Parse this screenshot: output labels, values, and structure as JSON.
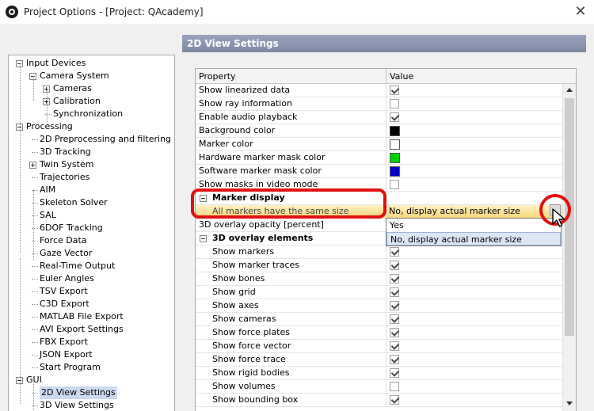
{
  "window": {
    "title": "Project Options - [Project: QAcademy]",
    "close_glyph": "✕"
  },
  "tree": [
    {
      "label": "Input Devices",
      "expander": "minus"
    },
    {
      "label": "Camera System",
      "expander": "minus"
    },
    {
      "label": "Cameras",
      "expander": "plus"
    },
    {
      "label": "Calibration",
      "expander": "plus"
    },
    {
      "label": "Synchronization"
    },
    {
      "label": "Processing",
      "expander": "minus"
    },
    {
      "label": "2D Preprocessing and filtering"
    },
    {
      "label": "3D Tracking"
    },
    {
      "label": "Twin System",
      "expander": "plus"
    },
    {
      "label": "Trajectories"
    },
    {
      "label": "AIM"
    },
    {
      "label": "Skeleton Solver"
    },
    {
      "label": "SAL"
    },
    {
      "label": "6DOF Tracking"
    },
    {
      "label": "Force Data"
    },
    {
      "label": "Gaze Vector"
    },
    {
      "label": "Real-Time Output"
    },
    {
      "label": "Euler Angles"
    },
    {
      "label": "TSV Export"
    },
    {
      "label": "C3D Export"
    },
    {
      "label": "MATLAB File Export"
    },
    {
      "label": "AVI Export Settings"
    },
    {
      "label": "FBX Export"
    },
    {
      "label": "JSON Export"
    },
    {
      "label": "Start Program"
    },
    {
      "label": "GUI",
      "expander": "minus"
    },
    {
      "label": "2D View Settings",
      "selected": true
    },
    {
      "label": "3D View Settings"
    }
  ],
  "settings": {
    "header": "2D View Settings",
    "col_property": "Property",
    "col_value": "Value",
    "rows": [
      {
        "name": "Show linearized data",
        "type": "check",
        "checked": true
      },
      {
        "name": "Show ray information",
        "type": "check",
        "checked": false
      },
      {
        "name": "Enable audio playback",
        "type": "check",
        "checked": true
      },
      {
        "name": "Background color",
        "type": "color",
        "color": "#000000"
      },
      {
        "name": "Marker color",
        "type": "color",
        "color": "#ffffff"
      },
      {
        "name": "Hardware marker mask color",
        "type": "color",
        "color": "#00d000"
      },
      {
        "name": "Software marker mask color",
        "type": "color",
        "color": "#0000c8"
      },
      {
        "name": "Show masks in video mode",
        "type": "check",
        "checked": false
      },
      {
        "name": "Marker display",
        "type": "category"
      },
      {
        "name": "All markers have the same size",
        "type": "text",
        "value": "No, display actual marker size",
        "highlighted": true,
        "sub": true
      },
      {
        "name": "3D overlay opacity [percent]",
        "type": "text",
        "value": ""
      },
      {
        "name": "3D overlay elements",
        "type": "category"
      },
      {
        "name": "Show markers",
        "type": "check",
        "checked": true,
        "sub": true
      },
      {
        "name": "Show marker traces",
        "type": "check",
        "checked": true,
        "sub": true
      },
      {
        "name": "Show bones",
        "type": "check",
        "checked": true,
        "sub": true
      },
      {
        "name": "Show grid",
        "type": "check",
        "checked": true,
        "sub": true
      },
      {
        "name": "Show axes",
        "type": "check",
        "checked": true,
        "sub": true
      },
      {
        "name": "Show cameras",
        "type": "check",
        "checked": true,
        "sub": true
      },
      {
        "name": "Show force plates",
        "type": "check",
        "checked": true,
        "sub": true
      },
      {
        "name": "Show force vector",
        "type": "check",
        "checked": true,
        "sub": true
      },
      {
        "name": "Show force trace",
        "type": "check",
        "checked": true,
        "sub": true
      },
      {
        "name": "Show rigid bodies",
        "type": "check",
        "checked": true,
        "sub": true
      },
      {
        "name": "Show volumes",
        "type": "check",
        "checked": false,
        "sub": true
      },
      {
        "name": "Show bounding box",
        "type": "check",
        "checked": true,
        "sub": true
      }
    ]
  },
  "dropdown": {
    "options": [
      "Yes",
      "No, display actual marker size"
    ],
    "selected_index": 1
  },
  "colors": {
    "highlight_ring": "#e01010",
    "header_bg": "#8791ab",
    "selection": "#ccdaf0"
  }
}
